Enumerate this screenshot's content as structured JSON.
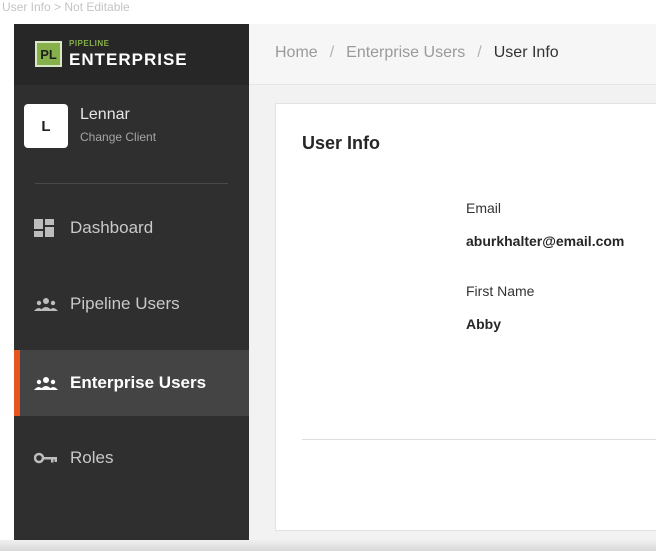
{
  "page_caption": "User Info > Not Editable",
  "logo": {
    "mark": "PL",
    "small": "PIPELINE",
    "big": "ENTERPRISE"
  },
  "client": {
    "initial": "L",
    "name": "Lennar",
    "action": "Change Client"
  },
  "nav": [
    {
      "label": "Dashboard",
      "icon": "dashboard-icon"
    },
    {
      "label": "Pipeline Users",
      "icon": "users-group-icon"
    },
    {
      "label": "Enterprise Users",
      "icon": "users-group-icon",
      "active": true
    },
    {
      "label": "Roles",
      "icon": "key-icon"
    }
  ],
  "breadcrumb": {
    "home": "Home",
    "parent": "Enterprise Users",
    "current": "User Info",
    "separator": "/"
  },
  "card": {
    "title": "User Info",
    "email_label": "Email",
    "email_value": "aburkhalter@email.com",
    "first_name_label": "First Name",
    "first_name_value": "Abby"
  },
  "colors": {
    "accent": "#e6541f",
    "logo_green": "#86b04a",
    "sidebar": "#2f2f2f"
  }
}
